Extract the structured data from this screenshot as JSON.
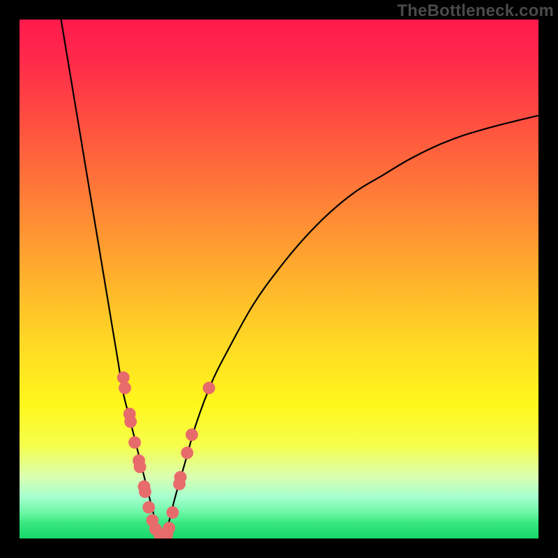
{
  "watermark": "TheBottleneck.com",
  "chart_data": {
    "type": "line",
    "title": "",
    "xlabel": "",
    "ylabel": "",
    "xlim": [
      0,
      100
    ],
    "ylim": [
      0,
      100
    ],
    "grid": false,
    "legend": false,
    "series": [
      {
        "name": "left-curve",
        "x": [
          8,
          10,
          12,
          14,
          16,
          18,
          19,
          20,
          21,
          22,
          23,
          24,
          25,
          26,
          26.8
        ],
        "y": [
          100,
          88,
          76,
          64,
          52,
          40,
          34,
          28,
          24,
          20,
          16,
          12,
          8,
          4,
          0
        ]
      },
      {
        "name": "right-curve",
        "x": [
          28,
          29,
          30,
          32,
          34,
          37,
          40,
          45,
          50,
          55,
          60,
          65,
          70,
          75,
          80,
          85,
          90,
          95,
          100
        ],
        "y": [
          0,
          4,
          8,
          15,
          22,
          30,
          36,
          45,
          52,
          58,
          63,
          67,
          70,
          73,
          75.5,
          77.5,
          79,
          80.3,
          81.5
        ]
      }
    ],
    "markers": {
      "name": "dots",
      "color": "#e86b6b",
      "radius_pct": 1.2,
      "points": [
        {
          "x": 20.0,
          "y": 31.0
        },
        {
          "x": 20.3,
          "y": 29.0
        },
        {
          "x": 21.2,
          "y": 24.0
        },
        {
          "x": 21.4,
          "y": 22.5
        },
        {
          "x": 22.2,
          "y": 18.5
        },
        {
          "x": 23.0,
          "y": 15.0
        },
        {
          "x": 23.2,
          "y": 13.8
        },
        {
          "x": 24.0,
          "y": 10.0
        },
        {
          "x": 24.2,
          "y": 9.0
        },
        {
          "x": 24.9,
          "y": 6.0
        },
        {
          "x": 25.6,
          "y": 3.5
        },
        {
          "x": 26.2,
          "y": 1.8
        },
        {
          "x": 27.0,
          "y": 0.8
        },
        {
          "x": 28.4,
          "y": 0.8
        },
        {
          "x": 28.8,
          "y": 2.0
        },
        {
          "x": 29.5,
          "y": 5.0
        },
        {
          "x": 30.8,
          "y": 10.5
        },
        {
          "x": 31.0,
          "y": 11.8
        },
        {
          "x": 32.3,
          "y": 16.5
        },
        {
          "x": 33.2,
          "y": 20.0
        },
        {
          "x": 36.5,
          "y": 29.0
        }
      ]
    }
  }
}
